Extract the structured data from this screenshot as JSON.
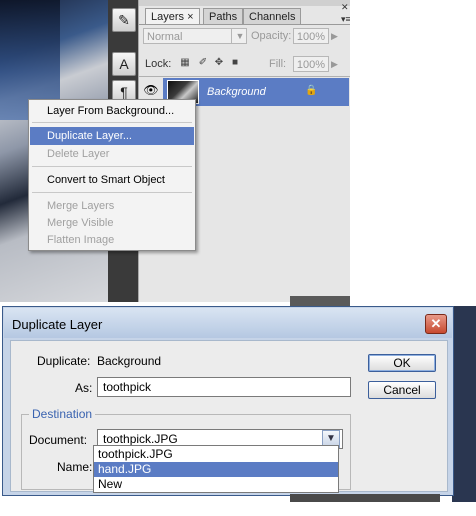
{
  "layers_panel": {
    "tabs": [
      {
        "label": "Layers",
        "close": "×"
      },
      {
        "label": "Paths"
      },
      {
        "label": "Channels"
      }
    ],
    "blend_mode": "Normal",
    "opacity_label": "Opacity:",
    "opacity_value": "100%",
    "lock_label": "Lock:",
    "fill_label": "Fill:",
    "fill_value": "100%",
    "layer": {
      "name": "Background"
    }
  },
  "context_menu": {
    "items": [
      {
        "label": "Layer From Background...",
        "enabled": true
      },
      {
        "label": "Duplicate Layer...",
        "enabled": true,
        "highlighted": true
      },
      {
        "label": "Delete Layer",
        "enabled": false
      },
      {
        "label": "Convert to Smart Object",
        "enabled": true
      },
      {
        "label": "Merge Layers",
        "enabled": false
      },
      {
        "label": "Merge Visible",
        "enabled": false
      },
      {
        "label": "Flatten Image",
        "enabled": false
      }
    ]
  },
  "dialog": {
    "title": "Duplicate Layer",
    "duplicate_label": "Duplicate:",
    "duplicate_value": "Background",
    "as_label": "As:",
    "as_value": "toothpick",
    "destination_label": "Destination",
    "document_label": "Document:",
    "document_value": "toothpick.JPG",
    "name_label": "Name:",
    "ok_label": "OK",
    "cancel_label": "Cancel",
    "dropdown_options": [
      "toothpick.JPG",
      "hand.JPG",
      "New"
    ],
    "dropdown_selected": "hand.JPG"
  },
  "colors": {
    "highlight": "#5b7cc4",
    "destination_text": "#3a63b0",
    "dialog_frame": "#c6d4e8"
  }
}
